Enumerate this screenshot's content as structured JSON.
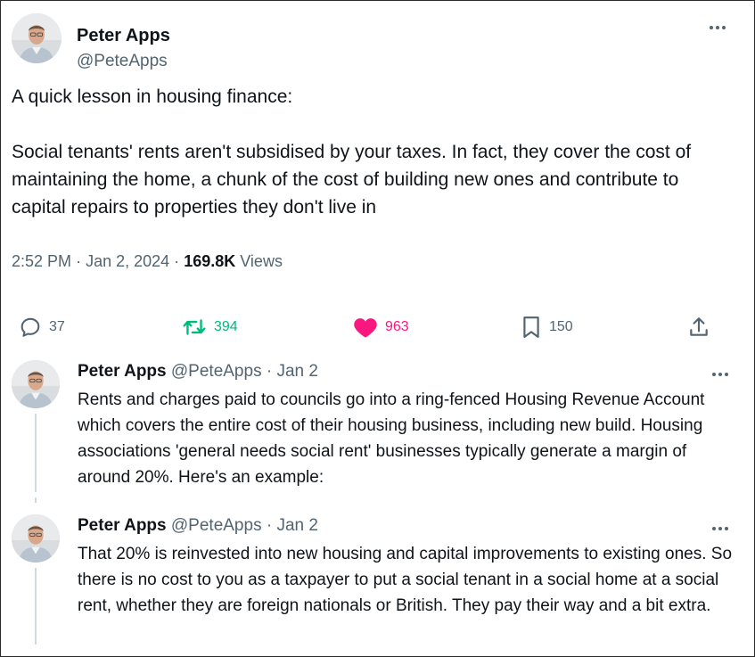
{
  "main": {
    "author_name": "Peter Apps",
    "author_handle": "@PeteApps",
    "text": "A quick lesson in housing finance:\n\nSocial tenants' rents aren't subsidised by your taxes. In fact, they cover the cost of maintaining the home, a chunk of the cost of building new ones and contribute to capital repairs to properties they don't live in",
    "time": "2:52 PM",
    "date": "Jan 2, 2024",
    "views_count": "169.8K",
    "views_label": "Views",
    "actions": {
      "replies": "37",
      "retweets": "394",
      "likes": "963",
      "bookmarks": "150"
    }
  },
  "replies": [
    {
      "author_name": "Peter Apps",
      "author_handle": "@PeteApps",
      "date": "Jan 2",
      "text": "Rents and charges paid to councils go into a ring-fenced Housing Revenue Account which covers the entire cost of their housing business, including new build. Housing associations 'general needs social rent' businesses typically generate a margin of around 20%. Here's an example:"
    },
    {
      "author_name": "Peter Apps",
      "author_handle": "@PeteApps",
      "date": "Jan 2",
      "text": "That 20% is reinvested into new housing and capital improvements to existing ones. So there is no cost to you as a taxpayer to put a social tenant in a social home at a social rent, whether they are foreign nationals or British. They pay their way and a bit extra."
    }
  ],
  "separator": "·",
  "icons": {
    "reply": "reply-icon",
    "retweet": "retweet-icon",
    "like": "heart-icon",
    "bookmark": "bookmark-icon",
    "share": "share-icon",
    "more": "more-icon"
  },
  "colors": {
    "text": "#0f1419",
    "secondary": "#536471",
    "retweet": "#00ba7c",
    "like": "#f91880",
    "thread_line": "#cfd9de"
  }
}
